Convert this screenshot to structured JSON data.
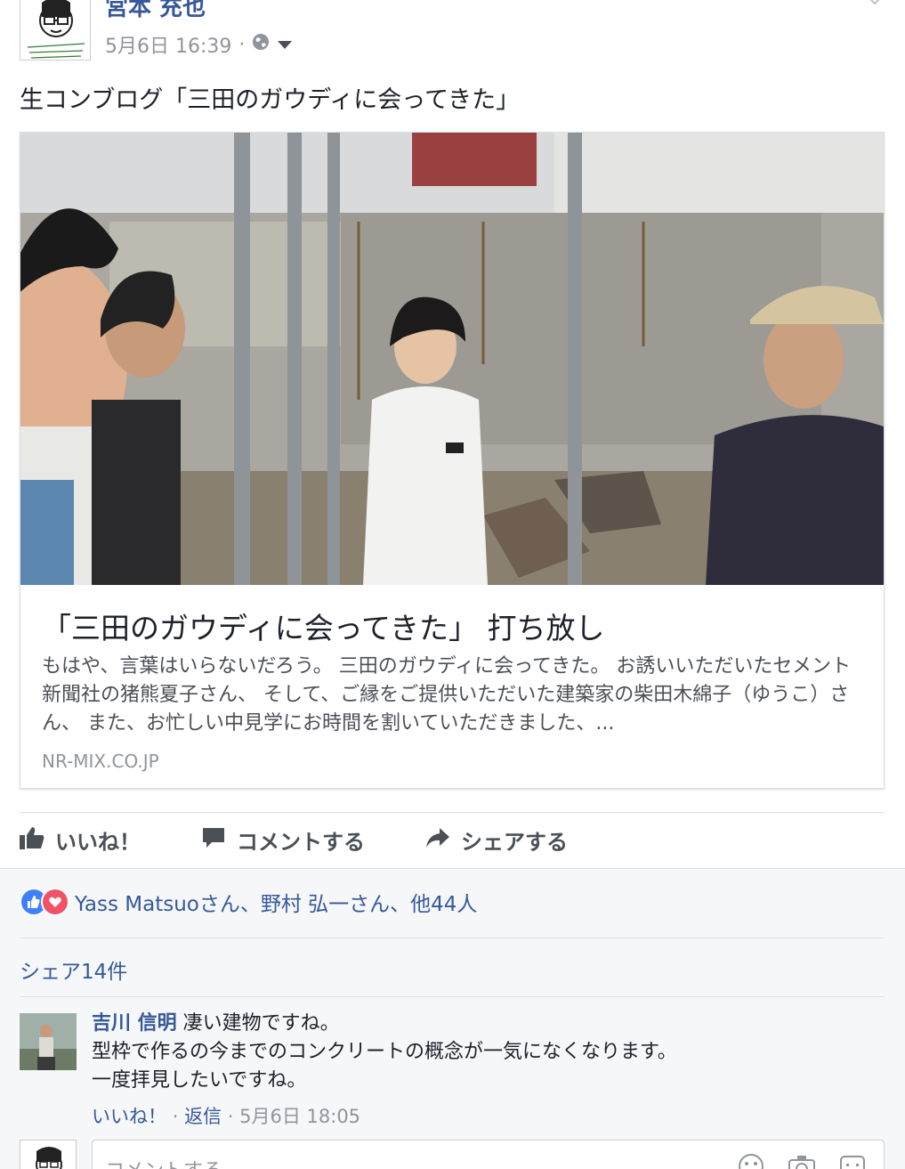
{
  "post": {
    "author": "宮本 充也",
    "timestamp": "5月6日 16:39",
    "separator": "·",
    "privacy_icon": "globe-icon",
    "text": "生コンブログ「三田のガウディに会ってきた」",
    "link": {
      "title": "「三田のガウディに会ってきた」 打ち放し",
      "description": "もはや、言葉はいらないだろう。 三田のガウディに会ってきた。 お誘いいただいたセメント新聞社の猪熊夏子さん、 そして、ご縁をご提供いただいた建築家の柴田木綿子（ゆうこ）さん、 また、お忙しい中見学にお時間を割いていただきました、...",
      "domain": "NR-MIX.CO.JP"
    },
    "actions": {
      "like": "いいね！",
      "comment": "コメントする",
      "share": "シェアする"
    }
  },
  "feedback": {
    "reactions_text": "Yass Matsuoさん、野村 弘一さん、他44人",
    "shares_text": "シェア14件",
    "comment": {
      "author": "吉川 信明",
      "line1": "凄い建物ですね。",
      "line2": "型枠で作るの今までのコンクリートの概念が一気になくなります。",
      "line3": "一度拝見したいですね。",
      "like_label": "いいね！",
      "dot": "·",
      "reply_label": "返信",
      "time": "5月6日 18:05"
    },
    "reply_placeholder": "コメントする"
  },
  "colors": {
    "link_blue": "#365899",
    "like_blue": "#4080ff",
    "love_red": "#f25268",
    "muted": "#90949c"
  }
}
